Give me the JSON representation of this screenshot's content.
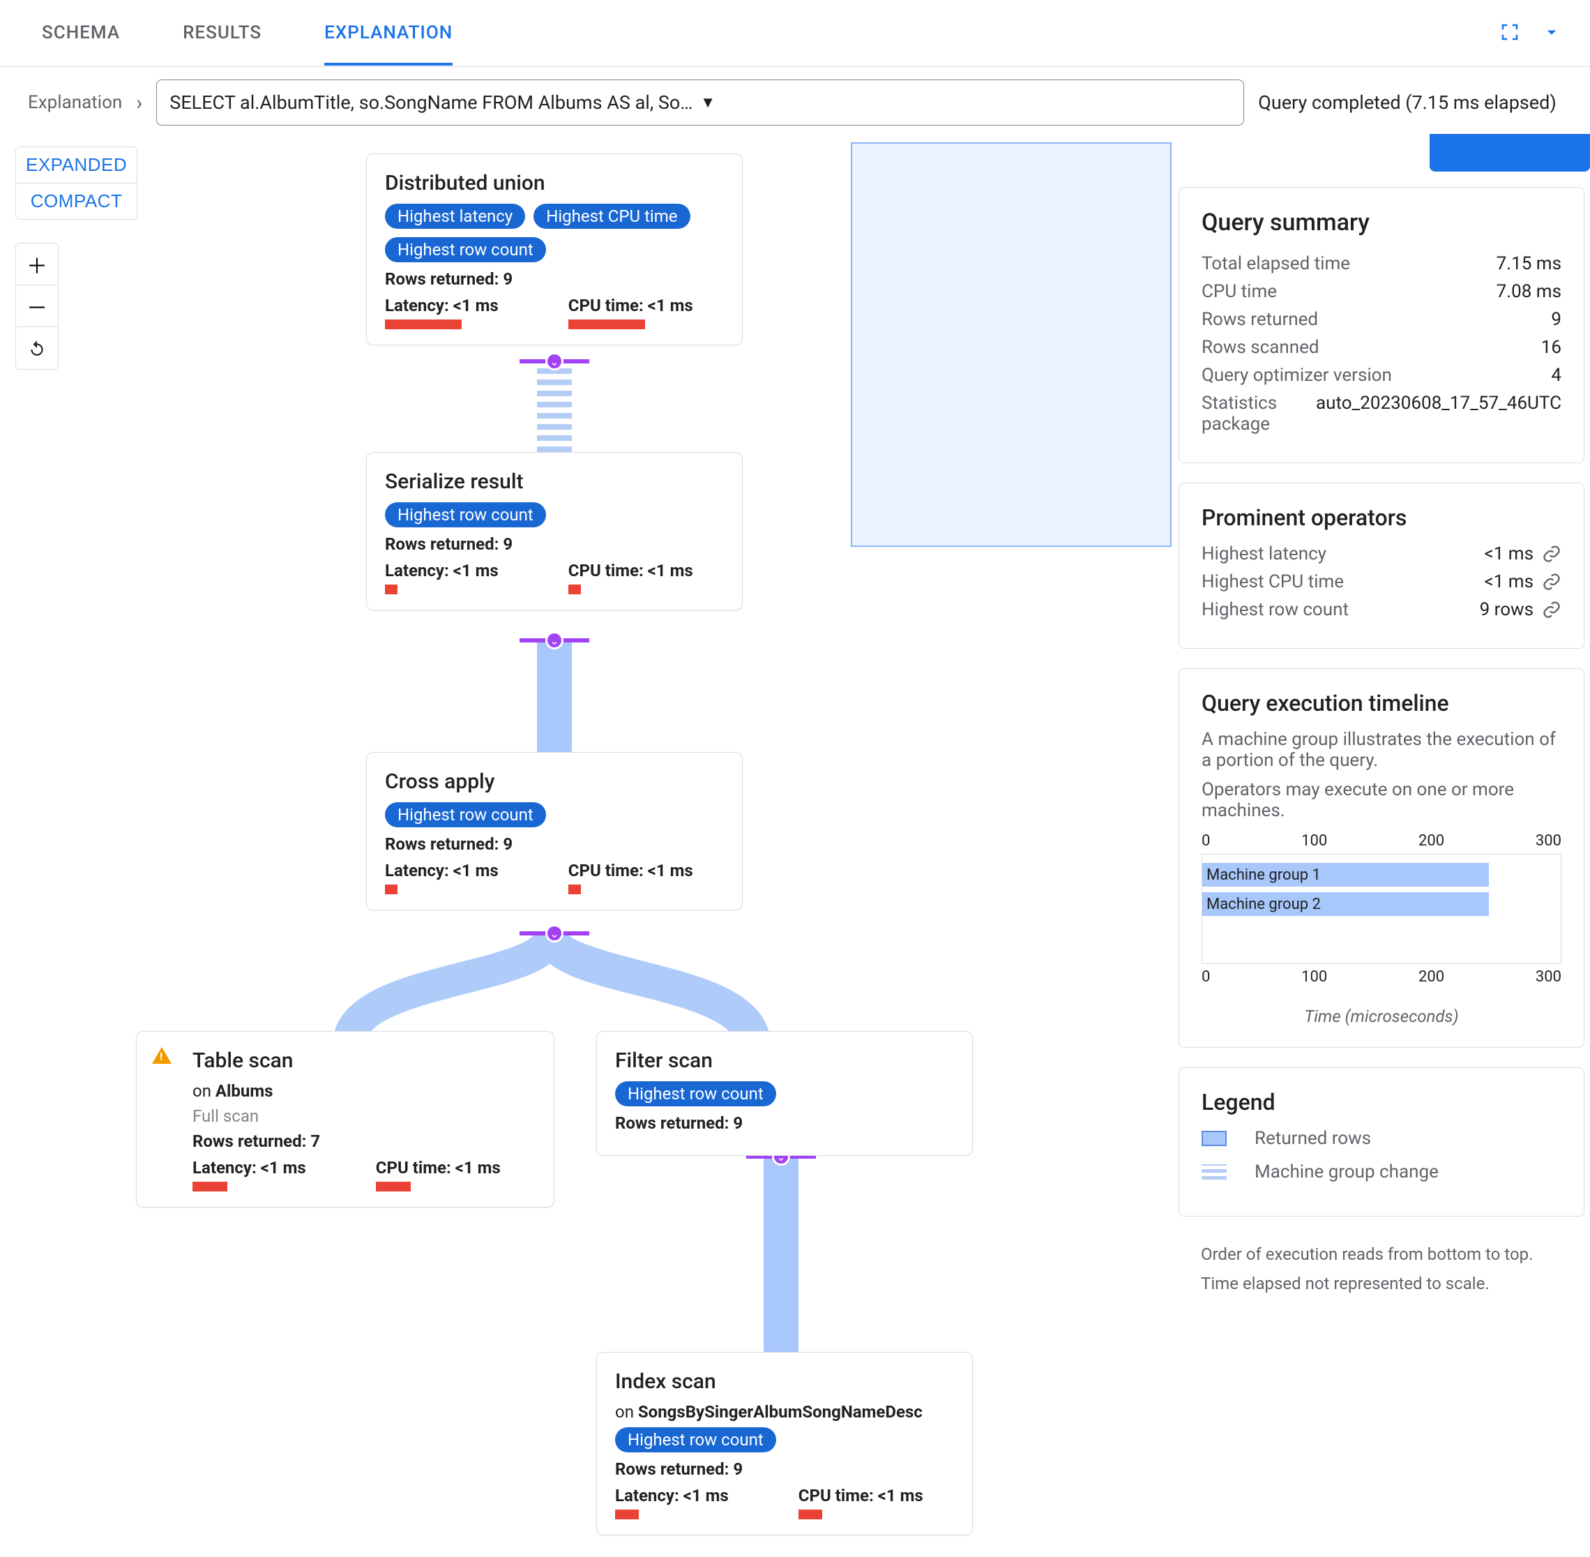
{
  "tabs": {
    "schema": "SCHEMA",
    "results": "RESULTS",
    "explanation": "EXPLANATION"
  },
  "crumb": "Explanation",
  "query": "SELECT al.AlbumTitle, so.SongName FROM Albums AS al, Songs AS so WHERE al.SingerId = so.SingerId AND al.AlbumId = so.Alb…",
  "completed": "Query completed (7.15 ms elapsed)",
  "view": {
    "expanded": "EXPANDED",
    "compact": "COMPACT"
  },
  "nodes": {
    "du": {
      "title": "Distributed union",
      "badges": [
        "Highest latency",
        "Highest CPU time",
        "Highest row count"
      ],
      "rows": "Rows returned: 9",
      "lat": "Latency: <1 ms",
      "cpu": "CPU time: <1 ms"
    },
    "sr": {
      "title": "Serialize result",
      "badges": [
        "Highest row count"
      ],
      "rows": "Rows returned: 9",
      "lat": "Latency: <1 ms",
      "cpu": "CPU time: <1 ms"
    },
    "ca": {
      "title": "Cross apply",
      "badges": [
        "Highest row count"
      ],
      "rows": "Rows returned: 9",
      "lat": "Latency: <1 ms",
      "cpu": "CPU time: <1 ms"
    },
    "ts": {
      "title": "Table scan",
      "on_prefix": "on ",
      "on_value": "Albums",
      "sub2": "Full scan",
      "rows": "Rows returned: 7",
      "lat": "Latency: <1 ms",
      "cpu": "CPU time: <1 ms"
    },
    "fs": {
      "title": "Filter scan",
      "badges": [
        "Highest row count"
      ],
      "rows": "Rows returned: 9"
    },
    "is": {
      "title": "Index scan",
      "on_prefix": "on ",
      "on_value": "SongsBySingerAlbumSongNameDesc",
      "badges": [
        "Highest row count"
      ],
      "rows": "Rows returned: 9",
      "lat": "Latency: <1 ms",
      "cpu": "CPU time: <1 ms"
    }
  },
  "summary": {
    "title": "Query summary",
    "rows": [
      {
        "k": "Total elapsed time",
        "v": "7.15 ms"
      },
      {
        "k": "CPU time",
        "v": "7.08 ms"
      },
      {
        "k": "Rows returned",
        "v": "9"
      },
      {
        "k": "Rows scanned",
        "v": "16"
      },
      {
        "k": "Query optimizer version",
        "v": "4"
      },
      {
        "k": "Statistics package",
        "v": "auto_20230608_17_57_46UTC"
      }
    ]
  },
  "prominent": {
    "title": "Prominent operators",
    "rows": [
      {
        "k": "Highest latency",
        "v": "<1 ms"
      },
      {
        "k": "Highest CPU time",
        "v": "<1 ms"
      },
      {
        "k": "Highest row count",
        "v": "9 rows"
      }
    ]
  },
  "timeline": {
    "title": "Query execution timeline",
    "desc1": "A machine group illustrates the execution of a portion of the query.",
    "desc2": "Operators may execute on one or more machines.",
    "ticks": [
      "0",
      "100",
      "200",
      "300"
    ],
    "bars": [
      "Machine group 1",
      "Machine group 2"
    ],
    "xlabel": "Time (microseconds)"
  },
  "legend": {
    "title": "Legend",
    "rows_label": "Returned rows",
    "change_label": "Machine group change",
    "foot1": "Order of execution reads from bottom to top.",
    "foot2": "Time elapsed not represented to scale."
  },
  "chart_data": {
    "type": "bar",
    "orientation": "horizontal",
    "categories": [
      "Machine group 1",
      "Machine group 2"
    ],
    "values": [
      250,
      250
    ],
    "xlabel": "Time (microseconds)",
    "xlim": [
      0,
      300
    ],
    "xticks": [
      0,
      100,
      200,
      300
    ]
  }
}
